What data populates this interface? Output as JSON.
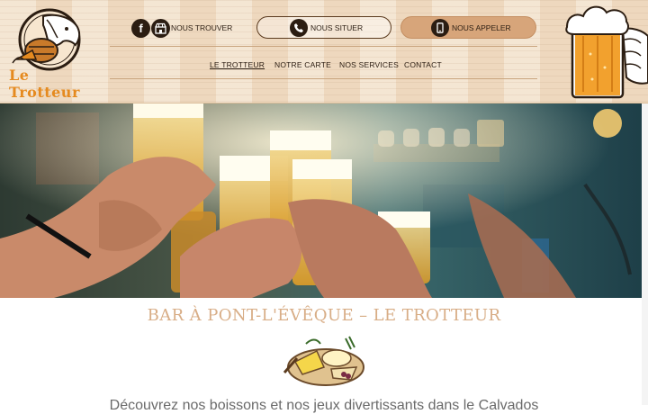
{
  "brand": {
    "name": "Le Trotteur",
    "accent_color": "#e58a1f"
  },
  "header": {
    "find_us_label": "NOUS TROUVER",
    "locate_button_label": "NOUS SITUER",
    "call_button_label": "NOUS APPELER",
    "icons": [
      "facebook-icon",
      "shop-icon",
      "phone-icon",
      "smartphone-icon"
    ]
  },
  "nav": {
    "items": [
      {
        "label": "LE TROTTEUR",
        "active": true
      },
      {
        "label": "NOTRE CARTE",
        "active": false
      },
      {
        "label": "NOS SERVICES",
        "active": false
      },
      {
        "label": "CONTACT",
        "active": false
      }
    ]
  },
  "main": {
    "title": "BAR À PONT-L'ÉVÊQUE – LE TROTTEUR",
    "intro": "Découvrez nos boissons et nos jeux divertissants dans le Calvados"
  },
  "colors": {
    "header_wood": "#f1ddc4",
    "dark_brown": "#2b1d12",
    "call_button": "#d7a57a",
    "title_color": "#d8ad86"
  }
}
